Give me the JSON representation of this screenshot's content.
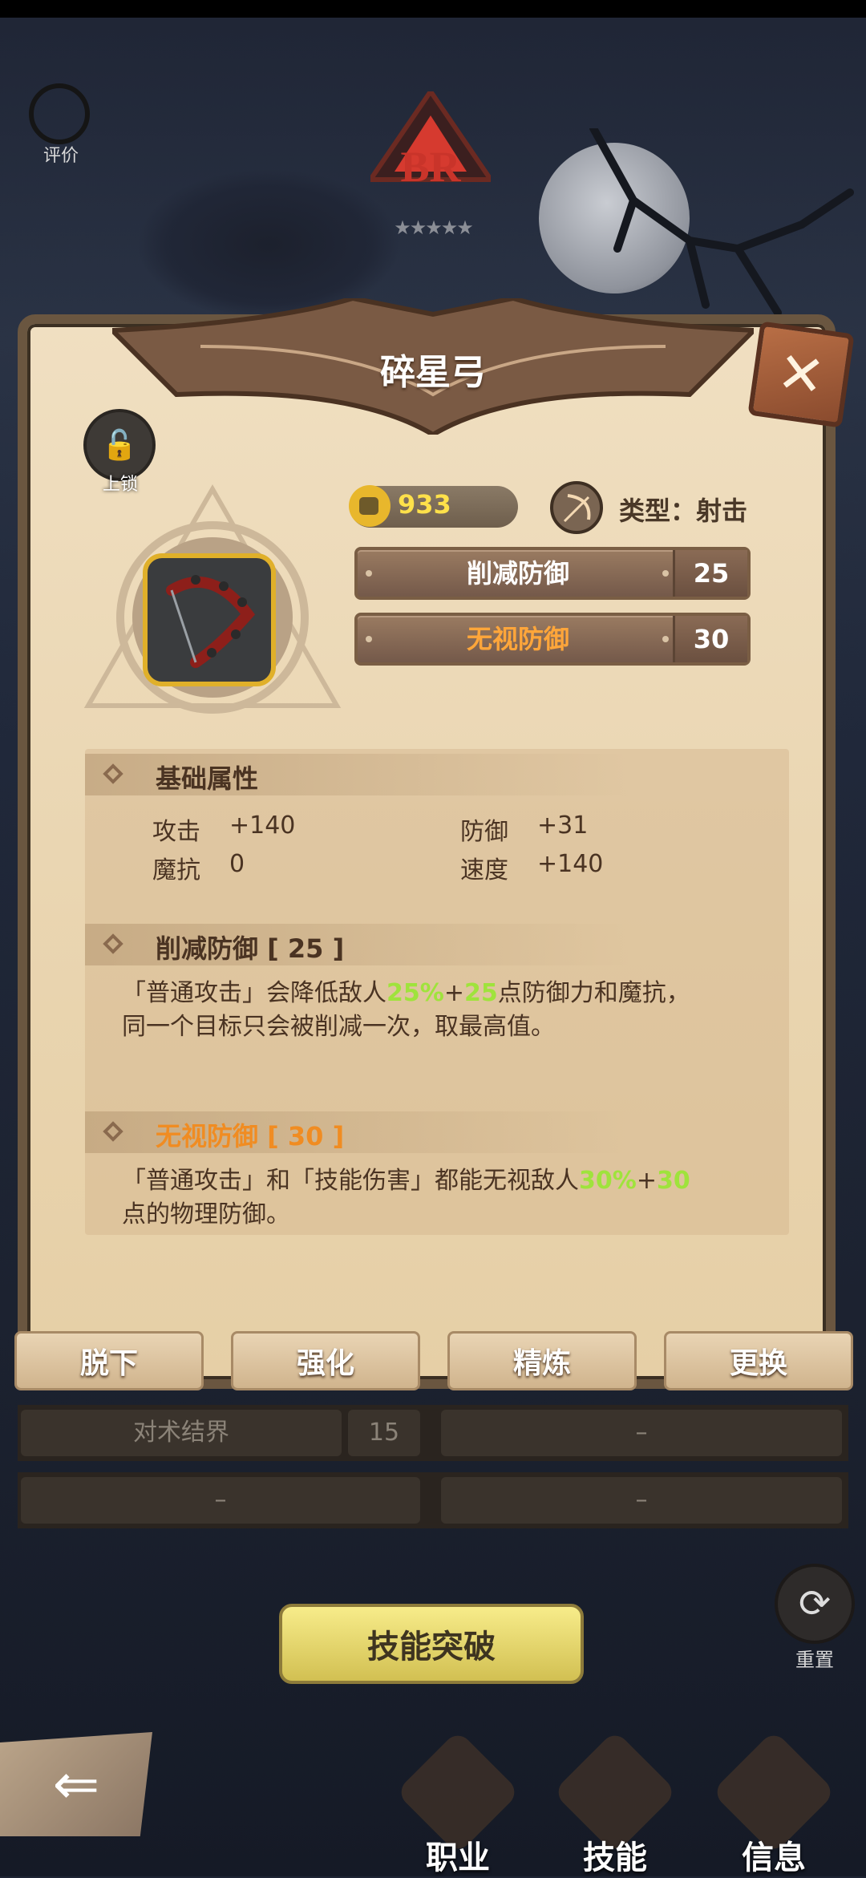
{
  "header": {
    "rating_label": "评价",
    "rank_badge": "BR",
    "stars": "★★★★★"
  },
  "panel": {
    "title": "碎星弓",
    "lock_label": "上锁",
    "attack_power": "933",
    "type_label": "类型：射击",
    "bonus_stats": [
      {
        "name": "削减防御",
        "value": "25"
      },
      {
        "name": "无视防御",
        "value": "30"
      }
    ],
    "base_section": {
      "title": "基础属性",
      "attrs": [
        {
          "name": "攻击",
          "value": "+140"
        },
        {
          "name": "防御",
          "value": "+31"
        },
        {
          "name": "魔抗",
          "value": "0"
        },
        {
          "name": "速度",
          "value": "+140"
        }
      ]
    },
    "skill1": {
      "title": "削减防御 [ 25 ]",
      "desc_a": "「普通攻击」会降低敌人",
      "hl1": "25%",
      "plus": "+",
      "hl2": "25",
      "desc_b": "点防御力和魔抗，",
      "desc_line2": "同一个目标只会被削减一次，取最高值。"
    },
    "skill2": {
      "title": "无视防御 [ 30 ]",
      "desc_a": "「普通攻击」和「技能伤害」都能无视敌人",
      "hl1": "30%",
      "plus": "+",
      "hl2": "30",
      "desc_line2": "点的物理防御。"
    },
    "actions": [
      "脱下",
      "强化",
      "精炼",
      "更换"
    ]
  },
  "skill_table": {
    "row1": {
      "name": "对术结界",
      "value": "15",
      "right": "–"
    },
    "row2": {
      "left": "–",
      "right": "–"
    }
  },
  "bottom": {
    "breakthrough_label": "技能突破",
    "reset_label": "重置",
    "nav": [
      "职业",
      "技能",
      "信息"
    ]
  },
  "colors": {
    "accent_yellow": "#ffe14a",
    "highlight_green": "#9fe33c",
    "orange": "#f08c22",
    "panel_bg": "#ead6b2"
  }
}
